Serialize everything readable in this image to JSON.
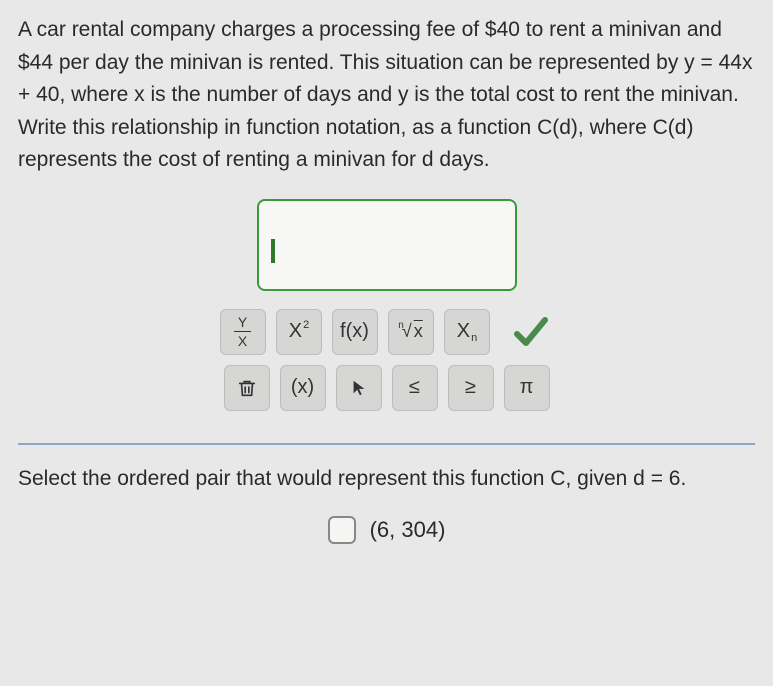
{
  "question": {
    "text": "A car rental company charges a processing fee of $40 to rent a minivan and $44 per day the minivan is rented. This situation can be represented by y = 44x + 40, where x is the number of days and y is the total cost to rent the minivan. Write this relationship in function notation, as a function C(d), where C(d) represents the cost of renting a minivan for d days."
  },
  "toolbar": {
    "row1": {
      "fraction_num": "Y",
      "fraction_den": "X",
      "power_base": "X",
      "power_exp": "2",
      "func": "f(x)",
      "root_n": "n",
      "root_arg": "x",
      "subscript_base": "X",
      "subscript_sub": "n"
    },
    "row2": {
      "parens": "(x)",
      "le": "≤",
      "ge": "≥",
      "pi": "π"
    }
  },
  "followup": {
    "text": "Select the ordered pair that would represent this function C, given d = 6.",
    "option1": "(6, 304)"
  }
}
